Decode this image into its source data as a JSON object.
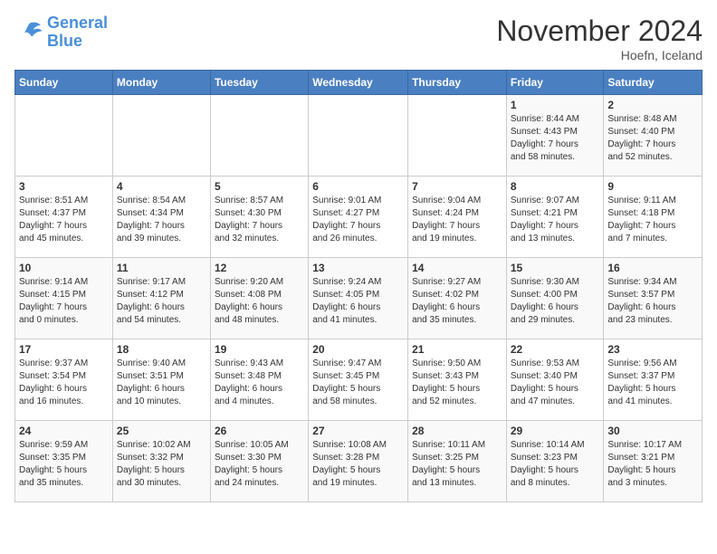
{
  "logo": {
    "line1": "General",
    "line2": "Blue"
  },
  "title": "November 2024",
  "location": "Hoefn, Iceland",
  "weekdays": [
    "Sunday",
    "Monday",
    "Tuesday",
    "Wednesday",
    "Thursday",
    "Friday",
    "Saturday"
  ],
  "weeks": [
    [
      {
        "day": "",
        "info": ""
      },
      {
        "day": "",
        "info": ""
      },
      {
        "day": "",
        "info": ""
      },
      {
        "day": "",
        "info": ""
      },
      {
        "day": "",
        "info": ""
      },
      {
        "day": "1",
        "info": "Sunrise: 8:44 AM\nSunset: 4:43 PM\nDaylight: 7 hours\nand 58 minutes."
      },
      {
        "day": "2",
        "info": "Sunrise: 8:48 AM\nSunset: 4:40 PM\nDaylight: 7 hours\nand 52 minutes."
      }
    ],
    [
      {
        "day": "3",
        "info": "Sunrise: 8:51 AM\nSunset: 4:37 PM\nDaylight: 7 hours\nand 45 minutes."
      },
      {
        "day": "4",
        "info": "Sunrise: 8:54 AM\nSunset: 4:34 PM\nDaylight: 7 hours\nand 39 minutes."
      },
      {
        "day": "5",
        "info": "Sunrise: 8:57 AM\nSunset: 4:30 PM\nDaylight: 7 hours\nand 32 minutes."
      },
      {
        "day": "6",
        "info": "Sunrise: 9:01 AM\nSunset: 4:27 PM\nDaylight: 7 hours\nand 26 minutes."
      },
      {
        "day": "7",
        "info": "Sunrise: 9:04 AM\nSunset: 4:24 PM\nDaylight: 7 hours\nand 19 minutes."
      },
      {
        "day": "8",
        "info": "Sunrise: 9:07 AM\nSunset: 4:21 PM\nDaylight: 7 hours\nand 13 minutes."
      },
      {
        "day": "9",
        "info": "Sunrise: 9:11 AM\nSunset: 4:18 PM\nDaylight: 7 hours\nand 7 minutes."
      }
    ],
    [
      {
        "day": "10",
        "info": "Sunrise: 9:14 AM\nSunset: 4:15 PM\nDaylight: 7 hours\nand 0 minutes."
      },
      {
        "day": "11",
        "info": "Sunrise: 9:17 AM\nSunset: 4:12 PM\nDaylight: 6 hours\nand 54 minutes."
      },
      {
        "day": "12",
        "info": "Sunrise: 9:20 AM\nSunset: 4:08 PM\nDaylight: 6 hours\nand 48 minutes."
      },
      {
        "day": "13",
        "info": "Sunrise: 9:24 AM\nSunset: 4:05 PM\nDaylight: 6 hours\nand 41 minutes."
      },
      {
        "day": "14",
        "info": "Sunrise: 9:27 AM\nSunset: 4:02 PM\nDaylight: 6 hours\nand 35 minutes."
      },
      {
        "day": "15",
        "info": "Sunrise: 9:30 AM\nSunset: 4:00 PM\nDaylight: 6 hours\nand 29 minutes."
      },
      {
        "day": "16",
        "info": "Sunrise: 9:34 AM\nSunset: 3:57 PM\nDaylight: 6 hours\nand 23 minutes."
      }
    ],
    [
      {
        "day": "17",
        "info": "Sunrise: 9:37 AM\nSunset: 3:54 PM\nDaylight: 6 hours\nand 16 minutes."
      },
      {
        "day": "18",
        "info": "Sunrise: 9:40 AM\nSunset: 3:51 PM\nDaylight: 6 hours\nand 10 minutes."
      },
      {
        "day": "19",
        "info": "Sunrise: 9:43 AM\nSunset: 3:48 PM\nDaylight: 6 hours\nand 4 minutes."
      },
      {
        "day": "20",
        "info": "Sunrise: 9:47 AM\nSunset: 3:45 PM\nDaylight: 5 hours\nand 58 minutes."
      },
      {
        "day": "21",
        "info": "Sunrise: 9:50 AM\nSunset: 3:43 PM\nDaylight: 5 hours\nand 52 minutes."
      },
      {
        "day": "22",
        "info": "Sunrise: 9:53 AM\nSunset: 3:40 PM\nDaylight: 5 hours\nand 47 minutes."
      },
      {
        "day": "23",
        "info": "Sunrise: 9:56 AM\nSunset: 3:37 PM\nDaylight: 5 hours\nand 41 minutes."
      }
    ],
    [
      {
        "day": "24",
        "info": "Sunrise: 9:59 AM\nSunset: 3:35 PM\nDaylight: 5 hours\nand 35 minutes."
      },
      {
        "day": "25",
        "info": "Sunrise: 10:02 AM\nSunset: 3:32 PM\nDaylight: 5 hours\nand 30 minutes."
      },
      {
        "day": "26",
        "info": "Sunrise: 10:05 AM\nSunset: 3:30 PM\nDaylight: 5 hours\nand 24 minutes."
      },
      {
        "day": "27",
        "info": "Sunrise: 10:08 AM\nSunset: 3:28 PM\nDaylight: 5 hours\nand 19 minutes."
      },
      {
        "day": "28",
        "info": "Sunrise: 10:11 AM\nSunset: 3:25 PM\nDaylight: 5 hours\nand 13 minutes."
      },
      {
        "day": "29",
        "info": "Sunrise: 10:14 AM\nSunset: 3:23 PM\nDaylight: 5 hours\nand 8 minutes."
      },
      {
        "day": "30",
        "info": "Sunrise: 10:17 AM\nSunset: 3:21 PM\nDaylight: 5 hours\nand 3 minutes."
      }
    ]
  ]
}
